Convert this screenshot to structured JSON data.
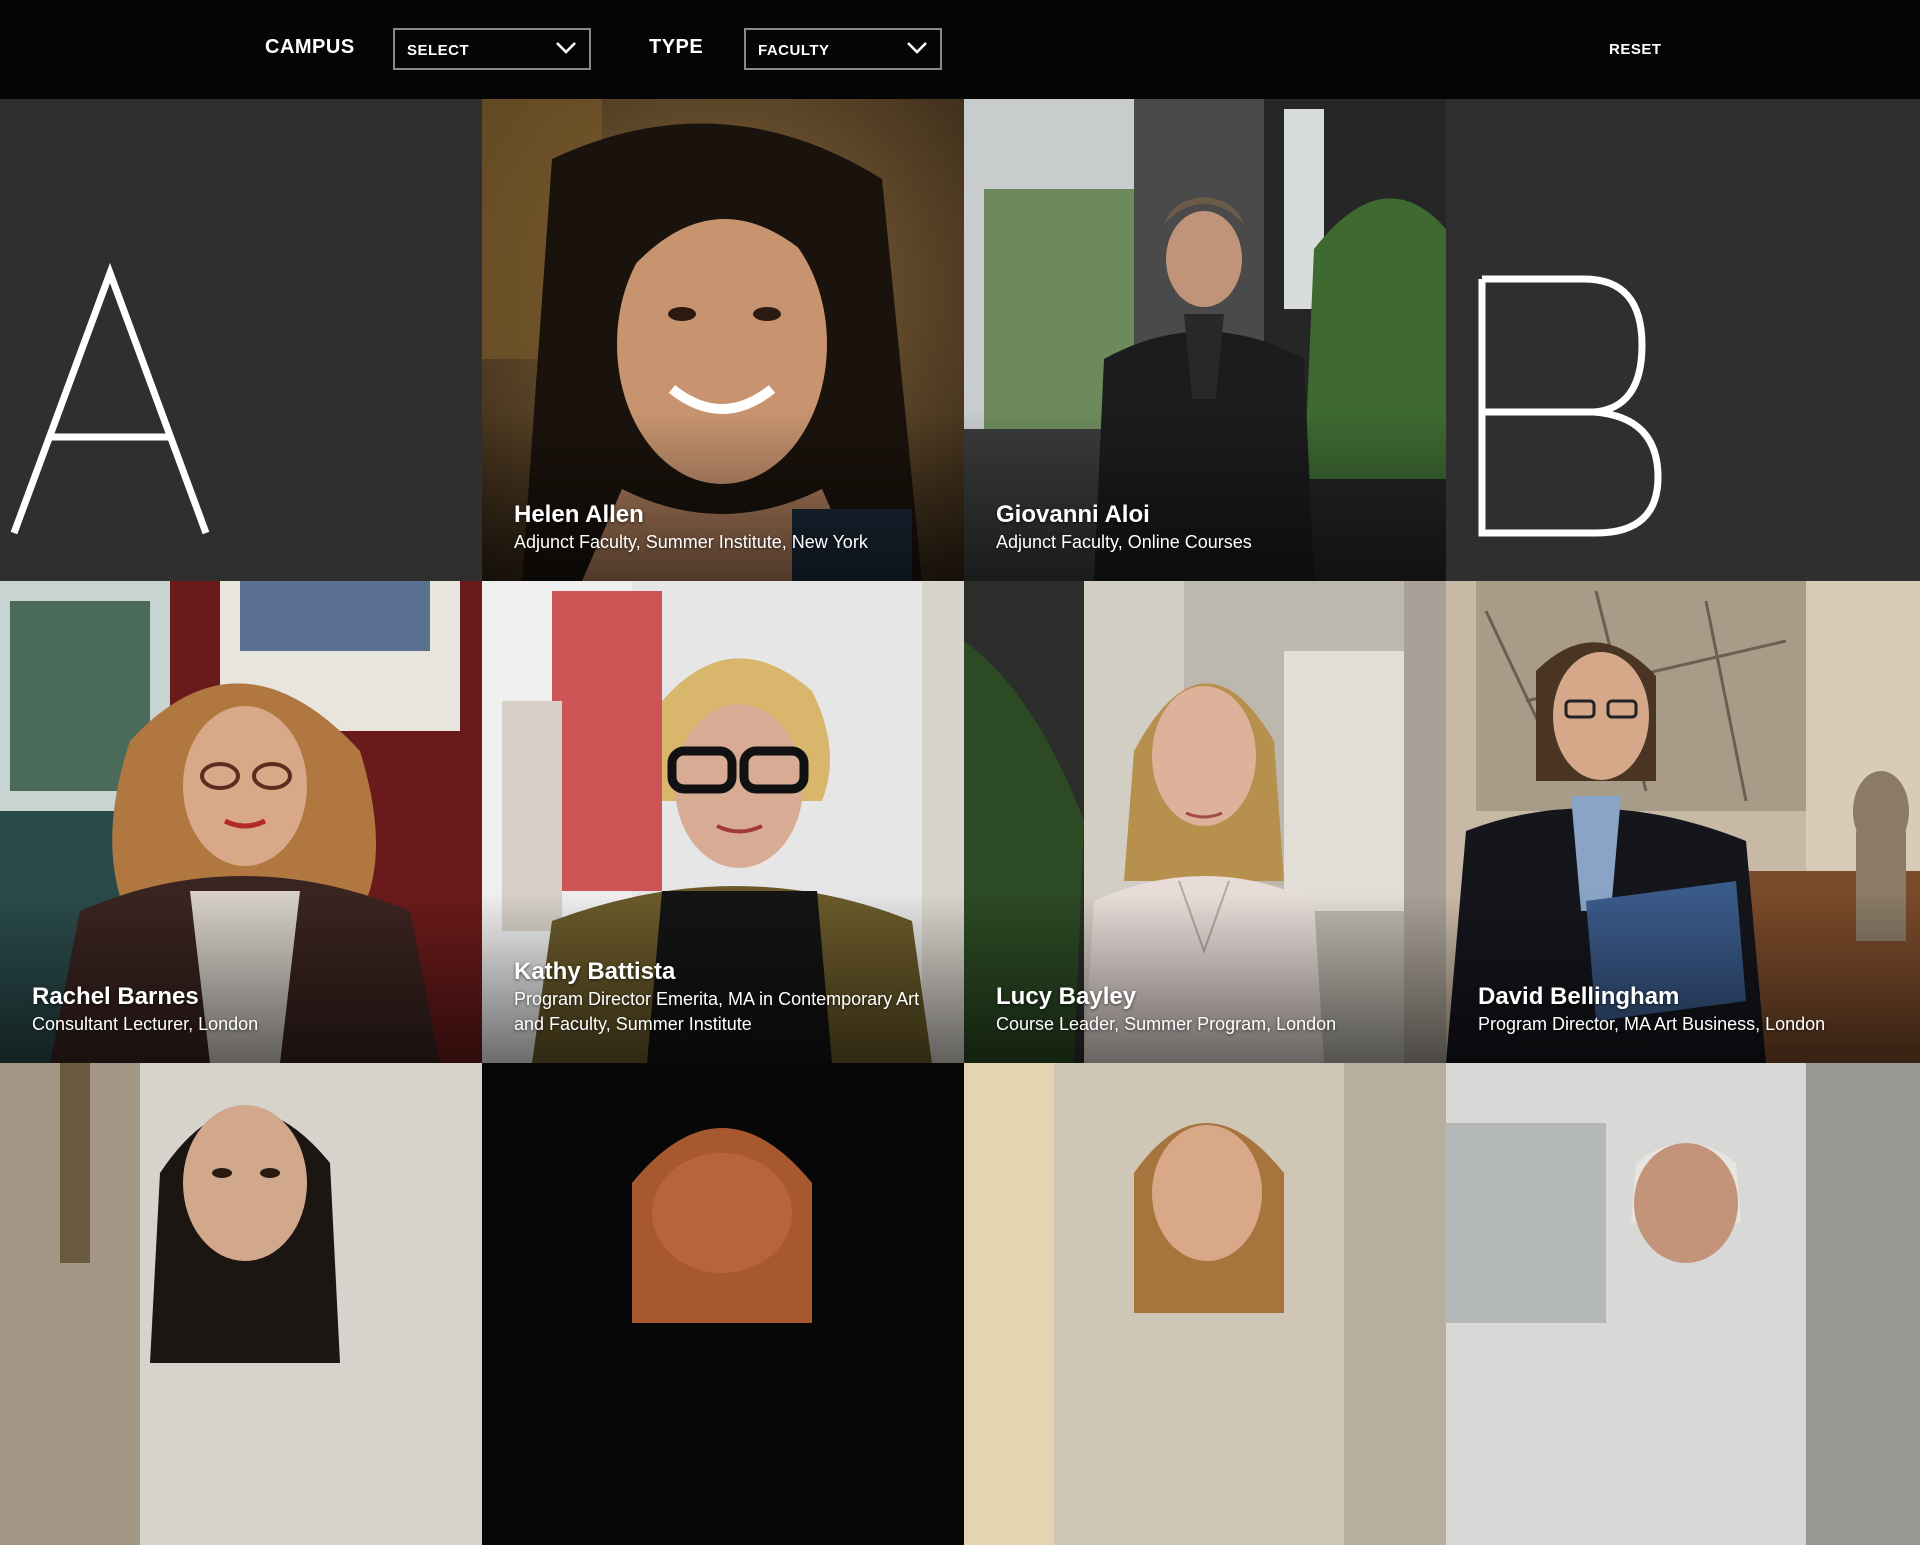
{
  "filters": {
    "campus_label": "CAMPUS",
    "campus_value": "SELECT",
    "type_label": "TYPE",
    "type_value": "FACULTY",
    "reset_label": "RESET"
  },
  "letters": [
    "A",
    "B"
  ],
  "people": [
    {
      "name": "Helen Allen",
      "role": "Adjunct Faculty, Summer Institute, New York"
    },
    {
      "name": "Giovanni Aloi",
      "role": "Adjunct Faculty, Online Courses"
    },
    {
      "name": "Rachel Barnes",
      "role": "Consultant Lecturer, London"
    },
    {
      "name": "Kathy Battista",
      "role": "Program Director Emerita, MA in Contemporary Art and Faculty, Summer Institute"
    },
    {
      "name": "Lucy Bayley",
      "role": "Course Leader, Summer Program, London"
    },
    {
      "name": "David Bellingham",
      "role": "Program Director, MA Art Business, London"
    }
  ],
  "colors": {
    "header_bg": "#050505",
    "grid_bg": "#2f2f2f",
    "text": "#ffffff",
    "select_border": "#8a8a8a"
  },
  "icons": {
    "dropdown": "chevron-down-icon"
  }
}
